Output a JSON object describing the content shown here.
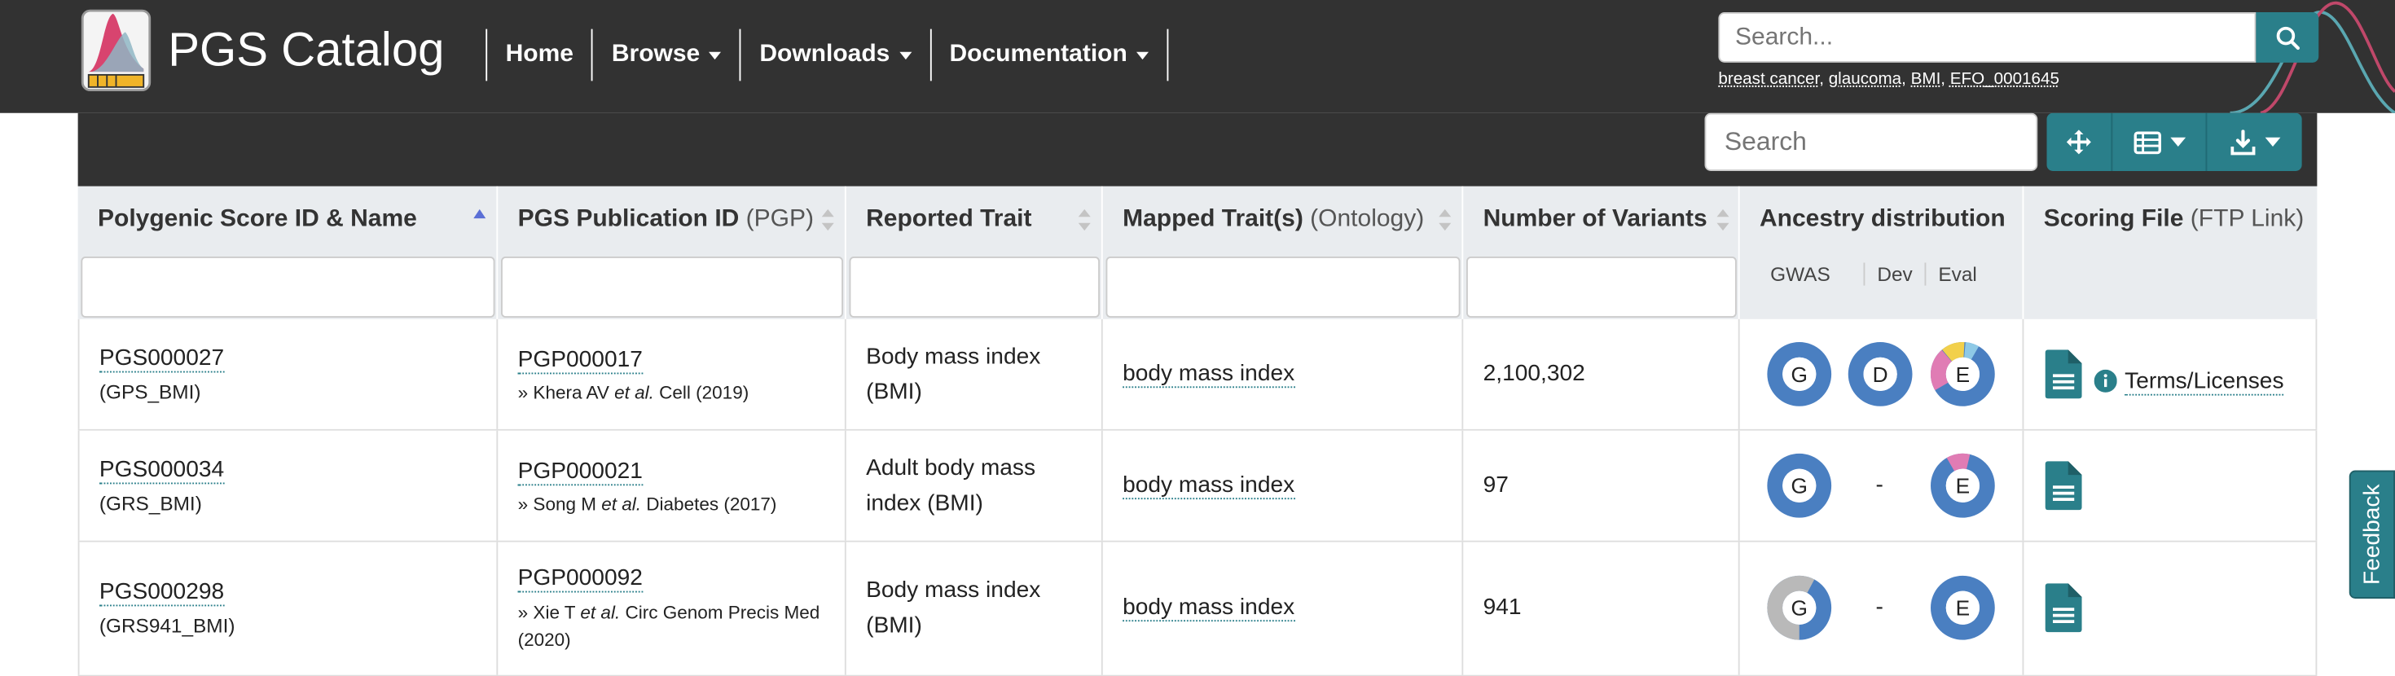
{
  "brand": {
    "name": "PGS Catalog"
  },
  "nav": {
    "items": [
      {
        "label": "Home",
        "dropdown": false
      },
      {
        "label": "Browse",
        "dropdown": true
      },
      {
        "label": "Downloads",
        "dropdown": true
      },
      {
        "label": "Documentation",
        "dropdown": true
      }
    ]
  },
  "header_search": {
    "placeholder": "Search...",
    "examples": [
      "breast cancer",
      "glaucoma",
      "BMI",
      "EFO_0001645"
    ]
  },
  "toolbar": {
    "search_placeholder": "Search"
  },
  "table": {
    "columns": [
      {
        "title": "Polygenic Score ID & Name",
        "subtitle": "",
        "sorted": "asc"
      },
      {
        "title": "PGS Publication ID",
        "subtitle": "(PGP)",
        "sorted": "none"
      },
      {
        "title": "Reported Trait",
        "subtitle": "",
        "sorted": "none"
      },
      {
        "title": "Mapped Trait(s)",
        "subtitle": "(Ontology)",
        "sorted": "none"
      },
      {
        "title": "Number of Variants",
        "subtitle": "",
        "sorted": "none"
      },
      {
        "title": "Ancestry distribution",
        "subtitle": "",
        "sorted": "none"
      },
      {
        "title": "Scoring File",
        "subtitle": "(FTP Link)",
        "sorted": "none"
      }
    ],
    "ancestry_subheaders": [
      "GWAS",
      "Dev",
      "Eval"
    ],
    "rows": [
      {
        "pgs_id": "PGS000027",
        "pgs_name": "(GPS_BMI)",
        "pgp_id": "PGP000017",
        "pub_author": "Khera AV",
        "pub_etal": "et al.",
        "pub_rest": "Cell (2019)",
        "reported_trait": "Body mass index (BMI)",
        "mapped_trait": "body mass index",
        "variants": "2,100,302",
        "ancestry": {
          "gwas": "G",
          "dev": "D",
          "eval": "E",
          "dev_dash": ""
        },
        "terms": "Terms/Licenses"
      },
      {
        "pgs_id": "PGS000034",
        "pgs_name": "(GRS_BMI)",
        "pgp_id": "PGP000021",
        "pub_author": "Song M",
        "pub_etal": "et al.",
        "pub_rest": "Diabetes (2017)",
        "reported_trait": "Adult body mass index (BMI)",
        "mapped_trait": "body mass index",
        "variants": "97",
        "ancestry": {
          "gwas": "G",
          "dev": "",
          "eval": "E",
          "dev_dash": "-"
        },
        "terms": ""
      },
      {
        "pgs_id": "PGS000298",
        "pgs_name": "(GRS941_BMI)",
        "pgp_id": "PGP000092",
        "pub_author": "Xie T",
        "pub_etal": "et al.",
        "pub_rest": "Circ Genom Precis Med (2020)",
        "reported_trait": "Body mass index (BMI)",
        "mapped_trait": "body mass index",
        "variants": "941",
        "ancestry": {
          "gwas": "G",
          "dev": "",
          "eval": "E",
          "dev_dash": "-"
        },
        "terms": ""
      }
    ]
  },
  "feedback": {
    "label": "Feedback"
  },
  "colors": {
    "navbar": "#323232",
    "accent": "#2a7f8a",
    "ancestry_blue": "#4a7fc1",
    "ancestry_pink": "#e07cb4",
    "ancestry_yellow": "#f2d04b",
    "ancestry_lightblue": "#8ec9e6",
    "ancestry_grey": "#b9b9b9"
  }
}
